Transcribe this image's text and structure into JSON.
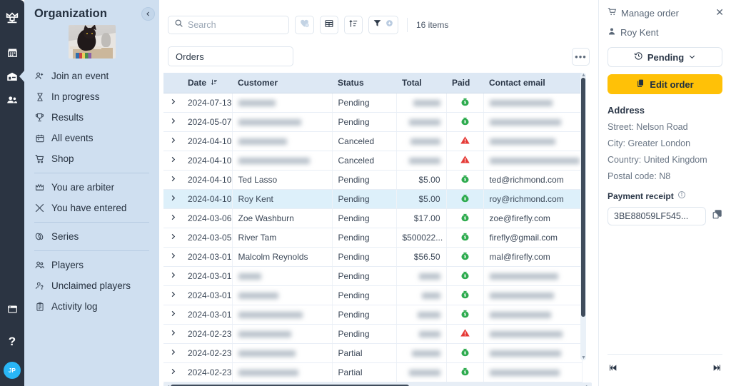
{
  "rail": {
    "logo_icon": "crown-logo-icon",
    "items": [
      {
        "icon": "calendar-icon",
        "name": "rail-item-calendar",
        "active": false
      },
      {
        "icon": "organization-icon",
        "name": "rail-item-organization",
        "active": true
      },
      {
        "icon": "people-icon",
        "name": "rail-item-people",
        "active": false
      }
    ],
    "bottom": [
      {
        "icon": "window-icon",
        "name": "rail-item-window"
      },
      {
        "icon": "help-icon",
        "name": "rail-item-help"
      }
    ],
    "avatar_initials": "JP"
  },
  "sidebar": {
    "title": "Organization",
    "collapse_icon": "chevron-left-icon",
    "photo_alt": "organization-photo",
    "groups": [
      {
        "items": [
          {
            "label": "Join an event",
            "icon": "user-plus-icon"
          },
          {
            "label": "In progress",
            "icon": "hourglass-icon"
          },
          {
            "label": "Results",
            "icon": "trophy-icon"
          },
          {
            "label": "All events",
            "icon": "calendar-icon"
          },
          {
            "label": "Shop",
            "icon": "cart-icon"
          }
        ]
      },
      {
        "items": [
          {
            "label": "You are arbiter",
            "icon": "arbiter-icon"
          },
          {
            "label": "You have entered",
            "icon": "swords-icon"
          }
        ]
      },
      {
        "items": [
          {
            "label": "Series",
            "icon": "link-icon"
          }
        ]
      },
      {
        "items": [
          {
            "label": "Players",
            "icon": "players-icon"
          },
          {
            "label": "Unclaimed players",
            "icon": "user-question-icon"
          },
          {
            "label": "Activity log",
            "icon": "clipboard-icon"
          }
        ]
      }
    ]
  },
  "toolbar": {
    "search_placeholder": "Search",
    "search_value": "",
    "search_icon": "search-icon",
    "buttons": [
      {
        "name": "favorites-button",
        "icon": "heart-plus-icon",
        "label": ""
      },
      {
        "name": "columns-button",
        "icon": "table-grid-icon",
        "label": ""
      },
      {
        "name": "sort-button",
        "icon": "sort-icon",
        "label": ""
      },
      {
        "name": "add-filter-button",
        "icon": "filter-plus-icon",
        "label": ""
      }
    ],
    "items_count": "16 items"
  },
  "tab_bar": {
    "active_tab": "Orders",
    "more_label": "•••"
  },
  "table": {
    "columns": [
      {
        "key": "expand",
        "label": ""
      },
      {
        "key": "date",
        "label": "Date",
        "sort_icon": "sort-desc-icon"
      },
      {
        "key": "customer",
        "label": "Customer"
      },
      {
        "key": "status",
        "label": "Status"
      },
      {
        "key": "total",
        "label": "Total"
      },
      {
        "key": "paid",
        "label": "Paid"
      },
      {
        "key": "email",
        "label": "Contact email"
      }
    ],
    "rows": [
      {
        "date": "2024-07-13",
        "customer": "",
        "customer_blur": true,
        "customer_w": 52,
        "status": "Pending",
        "total": "",
        "total_blur": true,
        "total_w": 38,
        "paid_icon": "money-bag-icon",
        "email": "",
        "email_blur": true,
        "email_w": 88,
        "selected": false
      },
      {
        "date": "2024-05-07",
        "customer": "",
        "customer_blur": true,
        "customer_w": 88,
        "status": "Pending",
        "total": "",
        "total_blur": true,
        "total_w": 44,
        "paid_icon": "money-bag-icon",
        "email": "",
        "email_blur": true,
        "email_w": 100,
        "selected": false
      },
      {
        "date": "2024-04-10",
        "customer": "",
        "customer_blur": true,
        "customer_w": 68,
        "status": "Canceled",
        "total": "",
        "total_blur": true,
        "total_w": 42,
        "paid_icon": "warning-icon",
        "email": "",
        "email_blur": true,
        "email_w": 92,
        "selected": false
      },
      {
        "date": "2024-04-10",
        "customer": "",
        "customer_blur": true,
        "customer_w": 100,
        "status": "Canceled",
        "total": "",
        "total_blur": true,
        "total_w": 44,
        "paid_icon": "warning-icon",
        "email": "",
        "email_blur": true,
        "email_w": 126,
        "selected": false
      },
      {
        "date": "2024-04-10",
        "customer": "Ted Lasso",
        "customer_blur": false,
        "status": "Pending",
        "total": "$5.00",
        "total_blur": false,
        "paid_icon": "money-bag-icon",
        "email": "ted@richmond.com",
        "email_blur": false,
        "selected": false
      },
      {
        "date": "2024-04-10",
        "customer": "Roy Kent",
        "customer_blur": false,
        "status": "Pending",
        "total": "$5.00",
        "total_blur": false,
        "paid_icon": "money-bag-icon",
        "email": "roy@richmond.com",
        "email_blur": false,
        "selected": true
      },
      {
        "date": "2024-03-06",
        "customer": "Zoe Washburn",
        "customer_blur": false,
        "status": "Pending",
        "total": "$17.00",
        "total_blur": false,
        "paid_icon": "money-bag-icon",
        "email": "zoe@firefly.com",
        "email_blur": false,
        "selected": false
      },
      {
        "date": "2024-03-05",
        "customer": "River Tam",
        "customer_blur": false,
        "status": "Pending",
        "total": "$500022...",
        "total_blur": false,
        "paid_icon": "money-bag-icon",
        "email": "firefly@gmail.com",
        "email_blur": false,
        "selected": false
      },
      {
        "date": "2024-03-01",
        "customer": "Malcolm Reynolds",
        "customer_blur": false,
        "status": "Pending",
        "total": "$56.50",
        "total_blur": false,
        "paid_icon": "money-bag-icon",
        "email": "mal@firefly.com",
        "email_blur": false,
        "selected": false
      },
      {
        "date": "2024-03-01",
        "customer": "",
        "customer_blur": true,
        "customer_w": 32,
        "status": "Pending",
        "total": "",
        "total_blur": true,
        "total_w": 30,
        "paid_icon": "money-bag-icon",
        "email": "",
        "email_blur": true,
        "email_w": 96,
        "selected": false
      },
      {
        "date": "2024-03-01",
        "customer": "",
        "customer_blur": true,
        "customer_w": 56,
        "status": "Pending",
        "total": "",
        "total_blur": true,
        "total_w": 26,
        "paid_icon": "money-bag-icon",
        "email": "",
        "email_blur": true,
        "email_w": 90,
        "selected": false
      },
      {
        "date": "2024-03-01",
        "customer": "",
        "customer_blur": true,
        "customer_w": 90,
        "status": "Pending",
        "total": "",
        "total_blur": true,
        "total_w": 32,
        "paid_icon": "money-bag-icon",
        "email": "",
        "email_blur": true,
        "email_w": 86,
        "selected": false
      },
      {
        "date": "2024-02-23",
        "customer": "",
        "customer_blur": true,
        "customer_w": 74,
        "status": "Pending",
        "total": "",
        "total_blur": true,
        "total_w": 30,
        "paid_icon": "warning-icon",
        "email": "",
        "email_blur": true,
        "email_w": 102,
        "selected": false
      },
      {
        "date": "2024-02-23",
        "customer": "",
        "customer_blur": true,
        "customer_w": 80,
        "status": "Partial",
        "total": "",
        "total_blur": true,
        "total_w": 40,
        "paid_icon": "money-bag-icon",
        "email": "",
        "email_blur": true,
        "email_w": 100,
        "selected": false
      },
      {
        "date": "2024-02-23",
        "customer": "",
        "customer_blur": true,
        "customer_w": 84,
        "status": "Partial",
        "total": "",
        "total_blur": true,
        "total_w": 44,
        "paid_icon": "money-bag-icon",
        "email": "",
        "email_blur": true,
        "email_w": 98,
        "selected": false
      }
    ]
  },
  "panel": {
    "header": "Manage order",
    "header_icon": "cart-icon",
    "close_icon": "close-icon",
    "person": "Roy Kent",
    "person_icon": "user-icon",
    "status_label": "Pending",
    "status_icon": "history-icon",
    "status_chevron": "chevron-down-icon",
    "edit_label": "Edit order",
    "edit_icon": "copy-doc-icon",
    "address_title": "Address",
    "address_lines": [
      "Street: Nelson Road",
      "City: Greater London",
      "Country: United Kingdom",
      "Postal code: N8"
    ],
    "receipt_label": "Payment receipt",
    "receipt_info_icon": "info-icon",
    "receipt_value": "3BE88059LF545...",
    "copy_icon": "copy-icon",
    "nav_first_icon": "skip-first-icon",
    "nav_last_icon": "skip-last-icon"
  },
  "colors": {
    "rail_bg": "#2b3442",
    "sidebar_bg": "#cfdff0",
    "table_header_bg": "#dde8f4",
    "selected_row": "#ddf0fa",
    "accent_amber": "#ffc107",
    "paid_green": "#2eab4f",
    "warning_red": "#e53935",
    "avatar_blue": "#29b6f6"
  }
}
